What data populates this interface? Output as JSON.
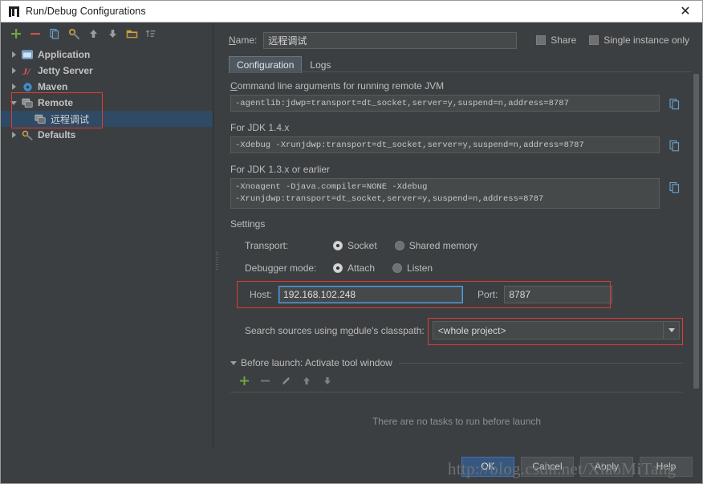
{
  "window": {
    "title": "Run/Debug Configurations",
    "app_icon": "intellij-idea-icon",
    "close_label": "✕"
  },
  "tree_toolbar": {
    "buttons": [
      {
        "name": "add-configuration-button",
        "icon": "plus-icon",
        "label": "+"
      },
      {
        "name": "remove-configuration-button",
        "icon": "minus-icon",
        "label": "−"
      },
      {
        "name": "copy-configuration-button",
        "icon": "copy-icon",
        "label": "Copy Configuration"
      },
      {
        "name": "edit-defaults-button",
        "icon": "wrench-icon",
        "label": "Edit defaults"
      },
      {
        "name": "move-up-button",
        "icon": "arrow-up-icon",
        "label": "Move Up"
      },
      {
        "name": "move-down-button",
        "icon": "arrow-down-icon",
        "label": "Move Down"
      },
      {
        "name": "create-folder-button",
        "icon": "folder-icon",
        "label": "Create New Folder"
      },
      {
        "name": "sort-configurations-button",
        "icon": "sort-icon",
        "label": "Sort Configurations"
      }
    ]
  },
  "tree": {
    "items": [
      {
        "label": "Application",
        "icon": "application-icon",
        "expanded": false,
        "selected": false,
        "child": false
      },
      {
        "label": "Jetty Server",
        "icon": "jetty-icon",
        "expanded": false,
        "selected": false,
        "child": false
      },
      {
        "label": "Maven",
        "icon": "maven-icon",
        "expanded": false,
        "selected": false,
        "child": false
      },
      {
        "label": "Remote",
        "icon": "remote-icon",
        "expanded": true,
        "selected": false,
        "child": false
      },
      {
        "label": "远程调试",
        "icon": "remote-icon",
        "expanded": null,
        "selected": true,
        "child": true
      },
      {
        "label": "Defaults",
        "icon": "defaults-icon",
        "expanded": false,
        "selected": false,
        "child": false
      }
    ]
  },
  "form": {
    "name_label": "Name:",
    "name_value": "远程调试",
    "share_label": "Share",
    "single_instance_label": "Single instance only",
    "tabs": [
      {
        "label": "Configuration",
        "active": true
      },
      {
        "label": "Logs",
        "active": false
      }
    ],
    "cmdline_label": "Command line arguments for running remote JVM",
    "cmdline_value": "-agentlib:jdwp=transport=dt_socket,server=y,suspend=n,address=8787",
    "jdk14_label": "For JDK 1.4.x",
    "jdk14_value": "-Xdebug -Xrunjdwp:transport=dt_socket,server=y,suspend=n,address=8787",
    "jdk13_label": "For JDK 1.3.x or earlier",
    "jdk13_value": "-Xnoagent -Djava.compiler=NONE -Xdebug\n-Xrunjdwp:transport=dt_socket,server=y,suspend=n,address=8787",
    "copy_icon": "copy-to-clipboard-icon",
    "settings_title": "Settings",
    "transport_label": "Transport:",
    "transport_options": [
      {
        "label": "Socket",
        "selected": true
      },
      {
        "label": "Shared memory",
        "selected": false
      }
    ],
    "debugger_mode_label": "Debugger mode:",
    "debugger_mode_options": [
      {
        "label": "Attach",
        "selected": true
      },
      {
        "label": "Listen",
        "selected": false
      }
    ],
    "host_label": "Host:",
    "host_value": "192.168.102.248",
    "port_label": "Port:",
    "port_value": "8787",
    "classpath_label": "Search sources using module's classpath:",
    "classpath_value": "<whole project>",
    "classpath_arrow_icon": "chevron-down-icon"
  },
  "before_launch": {
    "title": "Before launch: Activate tool window",
    "empty_text": "There are no tasks to run before launch",
    "toolbar": [
      {
        "name": "add-task-button",
        "icon": "plus-icon"
      },
      {
        "name": "remove-task-button",
        "icon": "minus-icon"
      },
      {
        "name": "edit-task-button",
        "icon": "pencil-icon"
      },
      {
        "name": "move-task-up-button",
        "icon": "arrow-up-icon"
      },
      {
        "name": "move-task-down-button",
        "icon": "arrow-down-icon"
      }
    ]
  },
  "footer": {
    "buttons": [
      {
        "label": "OK",
        "name": "ok-button",
        "default": true
      },
      {
        "label": "Cancel",
        "name": "cancel-button",
        "default": false
      },
      {
        "label": "Apply",
        "name": "apply-button",
        "default": false
      },
      {
        "label": "Help",
        "name": "help-button",
        "default": false
      }
    ]
  },
  "watermark": {
    "text": "http://blog.csdn.net/XiaoMiTang"
  },
  "colors": {
    "background": "#3c3f41",
    "field_background": "#45494a",
    "selection": "#2f4a64",
    "accent_button": "#365880",
    "annotation_red": "#e33b32",
    "focus_blue": "#5b9bd5"
  }
}
